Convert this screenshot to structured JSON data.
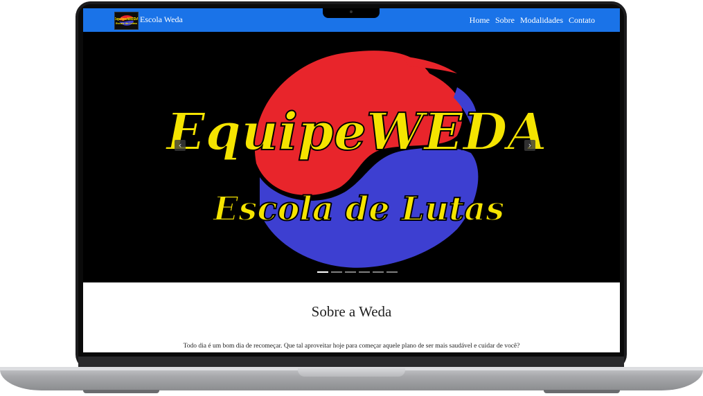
{
  "navbar": {
    "brand": "Escola Weda",
    "links": [
      "Home",
      "Sobre",
      "Modalidades",
      "Contato"
    ],
    "color": "#1a73e8"
  },
  "hero": {
    "title_line1": "EquipeWEDA",
    "title_line2": "Escola de Lutas",
    "text_color": "#f5e400",
    "colors": {
      "red": "#e8252b",
      "blue": "#3d3fd1",
      "background": "#000000"
    },
    "prev_icon": "chevron-left-icon",
    "next_icon": "chevron-right-icon",
    "slide_count": 6,
    "active_slide": 1
  },
  "about": {
    "heading": "Sobre a Weda",
    "text": "Todo dia é um bom dia de recomeçar. Que tal aproveitar hoje para começar aquele plano de ser mais saudável e cuidar de você?"
  }
}
